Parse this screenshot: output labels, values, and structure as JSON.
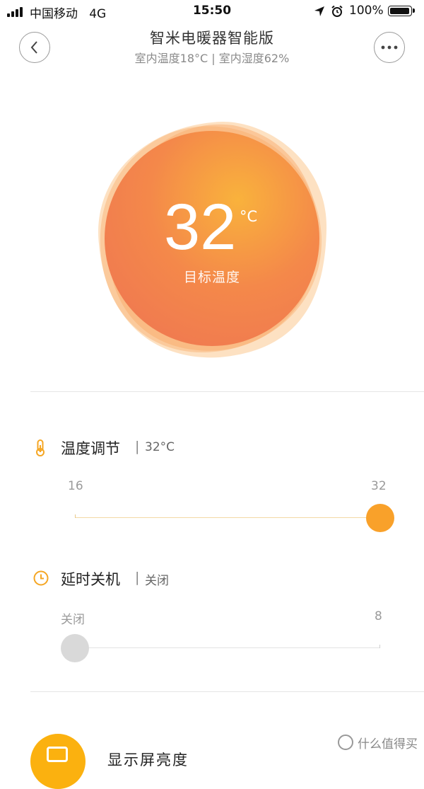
{
  "status_bar": {
    "carrier": "中国移动",
    "network": "4G",
    "time": "15:50",
    "battery": "100%",
    "battery_level": 1.0
  },
  "nav": {
    "title": "智米电暖器智能版",
    "subtitle": "室内温度18°C | 室内湿度62%",
    "back_icon": "chevron-left-icon",
    "more_icon": "more-dots-icon"
  },
  "dial": {
    "value": "32",
    "unit": "°C",
    "caption": "目标温度"
  },
  "temperature": {
    "title": "温度调节",
    "separator": "|",
    "value": "32°C",
    "min_label": "16",
    "max_label": "32",
    "min": 16,
    "max": 32,
    "current": 32,
    "icon": "thermometer-icon",
    "accent_color": "#f9a12a"
  },
  "timer": {
    "title": "延时关机",
    "separator": "|",
    "value": "关闭",
    "min_label": "关闭",
    "max_label": "8",
    "min": 0,
    "max": 8,
    "current": 0,
    "icon": "clock-icon",
    "thumb_color": "#d9d9d9"
  },
  "bottom": {
    "partial_label": "显示屏亮度",
    "icon": "display-icon",
    "color": "#fbb10f"
  },
  "watermark": {
    "text": "什么值得买"
  }
}
